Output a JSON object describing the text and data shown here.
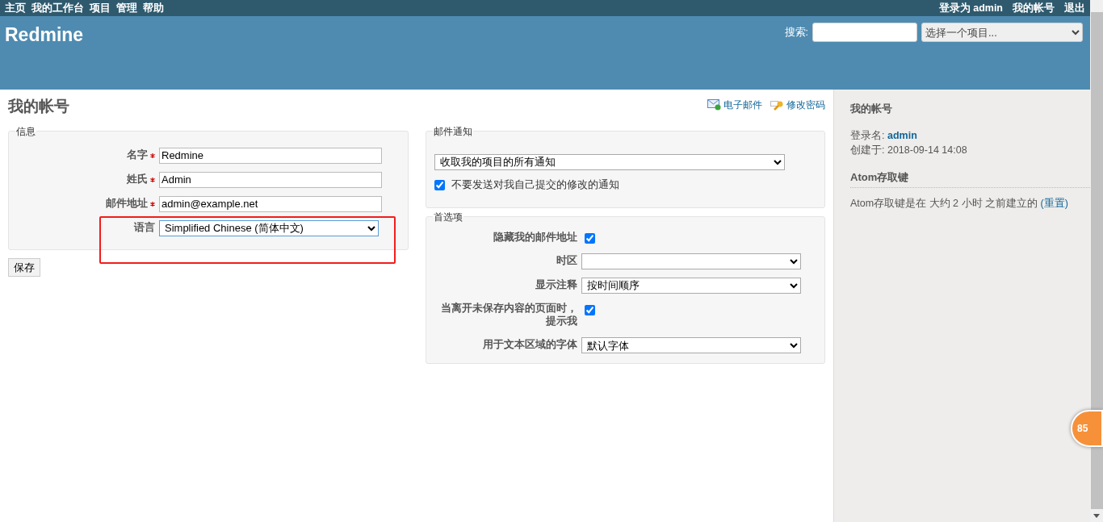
{
  "top_menu": {
    "items": [
      "主页",
      "我的工作台",
      "项目",
      "管理",
      "帮助"
    ],
    "logged_in_prefix": "登录为",
    "user": "admin",
    "account_links": [
      "我的帐号",
      "退出"
    ]
  },
  "header": {
    "title": "Redmine",
    "search_label": "搜索:",
    "project_select": "选择一个项目..."
  },
  "page_title": "我的帐号",
  "contextual_links": [
    {
      "label": "电子邮件",
      "kind": "mail"
    },
    {
      "label": "修改密码",
      "kind": "key"
    }
  ],
  "info": {
    "legend": "信息",
    "fields": [
      {
        "label": "名字",
        "required": true,
        "kind": "text",
        "value": "Redmine"
      },
      {
        "label": "姓氏",
        "required": true,
        "kind": "text",
        "value": "Admin"
      },
      {
        "label": "邮件地址",
        "required": true,
        "kind": "text",
        "value": "admin@example.net"
      },
      {
        "label": "语言",
        "required": false,
        "kind": "select",
        "value": "Simplified Chinese (简体中文)"
      }
    ]
  },
  "save_button": "保存",
  "mail_notification": {
    "legend": "邮件通知",
    "select": "收取我的项目的所有通知",
    "checkbox": {
      "label": "不要发送对我自己提交的修改的通知",
      "checked": true
    }
  },
  "preferences": {
    "legend": "首选项",
    "fields": [
      {
        "label": "隐藏我的邮件地址",
        "kind": "checkbox",
        "checked": true
      },
      {
        "label": "时区",
        "kind": "select"
      },
      {
        "label": "显示注释",
        "kind": "select",
        "value": "按时间顺序"
      },
      {
        "label": "当离开未保存内容的页面时，提示我",
        "kind": "checkbox",
        "checked": true
      },
      {
        "label": "用于文本区域的字体",
        "kind": "select",
        "value": "默认字体"
      }
    ]
  },
  "sidebar": {
    "title": "我的帐号",
    "login_label": "登录名:",
    "login": "admin",
    "created_label": "创建于:",
    "created": "2018-09-14 14:08",
    "atom_heading": "Atom存取键",
    "atom_text": "Atom存取键是在 大约 2 小时 之前建立的",
    "reset_link": "(重置)"
  },
  "float_badge": "85"
}
